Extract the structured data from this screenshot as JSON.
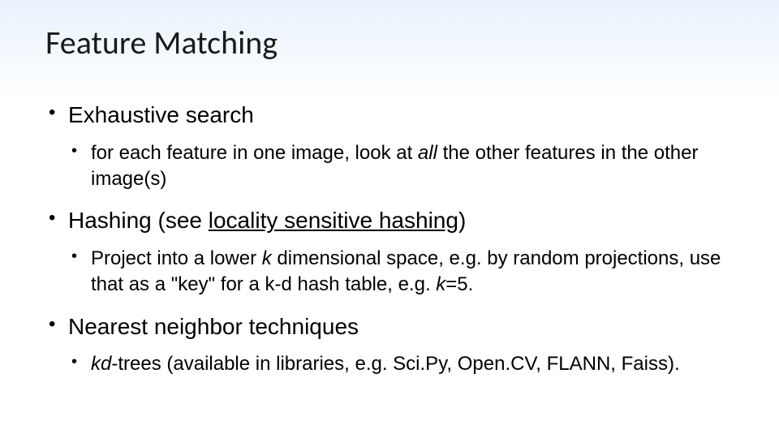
{
  "title": "Feature Matching",
  "bullets": [
    {
      "label": "Exhaustive search",
      "sub_pre": "for each feature in one image, look at ",
      "sub_italic1": "all",
      "sub_post": " the other features in the other image(s)"
    },
    {
      "label_pre": "Hashing (see ",
      "label_link": "locality sensitive hashing",
      "label_post": ")",
      "sub_pre": "Project into a lower ",
      "sub_italic1": "k",
      "sub_mid": " dimensional space, e.g. by random projections, use that as a \"key\" for a k-d hash table, e.g. ",
      "sub_italic2": "k",
      "sub_post": "=5."
    },
    {
      "label": "Nearest neighbor techniques",
      "sub_italic1": "kd",
      "sub_post": "-trees (available in libraries, e.g. Sci.Py, Open.CV, FLANN, Faiss)."
    }
  ]
}
